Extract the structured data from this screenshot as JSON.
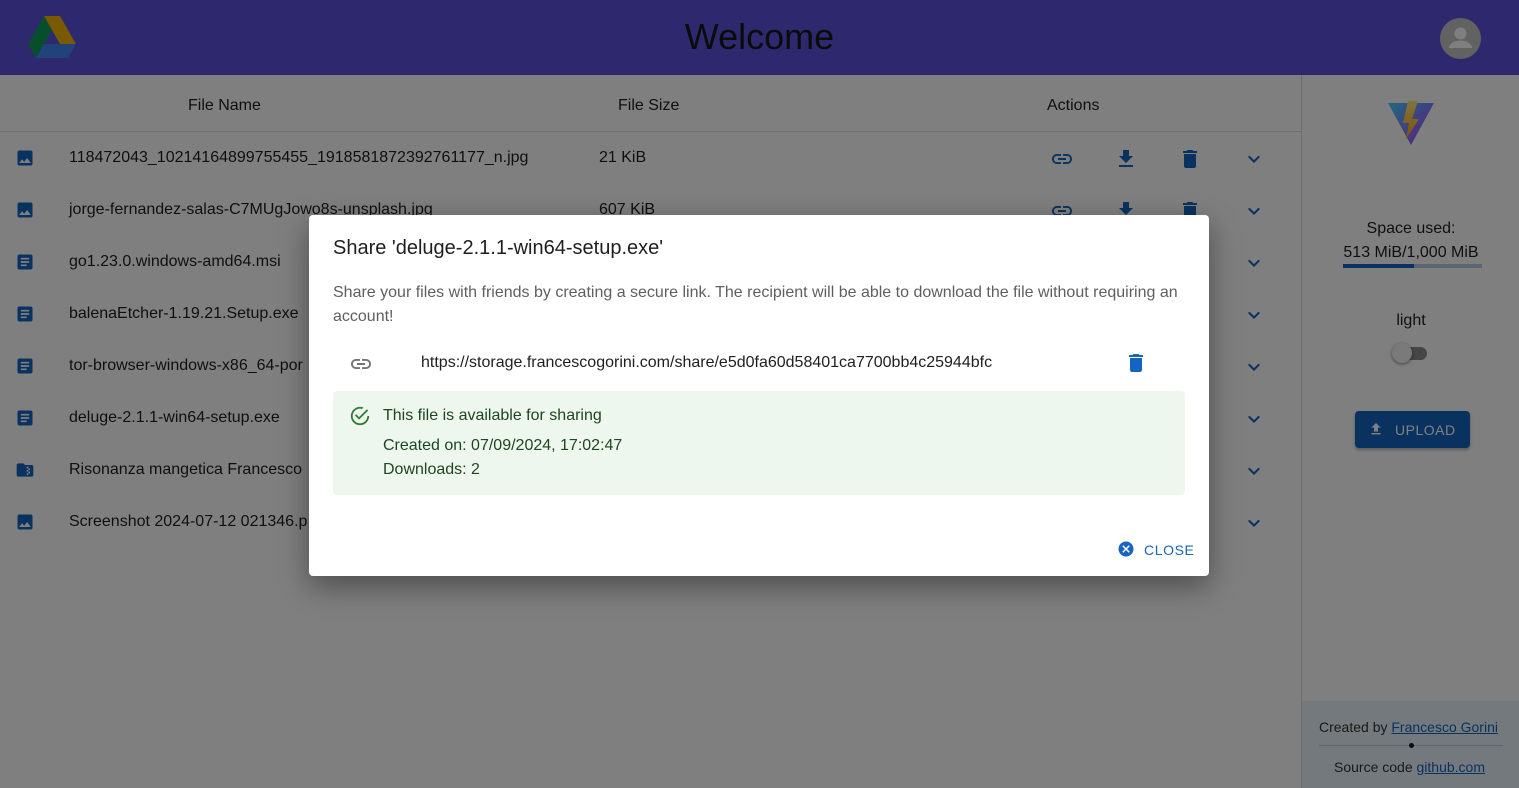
{
  "header": {
    "title": "Welcome"
  },
  "table": {
    "columns": {
      "name": "File Name",
      "size": "File Size",
      "actions": "Actions"
    },
    "rows": [
      {
        "icon": "image-icon",
        "name": "118472043_10214164899755455_1918581872392761177_n.jpg",
        "size": "21 KiB"
      },
      {
        "icon": "image-icon",
        "name": "jorge-fernandez-salas-C7MUgJowo8s-unsplash.jpg",
        "size": "607 KiB"
      },
      {
        "icon": "document-icon",
        "name": "go1.23.0.windows-amd64.msi",
        "size": ""
      },
      {
        "icon": "document-icon",
        "name": "balenaEtcher-1.19.21.Setup.exe",
        "size": ""
      },
      {
        "icon": "document-icon",
        "name": "tor-browser-windows-x86_64-por",
        "size": ""
      },
      {
        "icon": "document-icon",
        "name": "deluge-2.1.1-win64-setup.exe",
        "size": ""
      },
      {
        "icon": "archive-icon",
        "name": "Risonanza mangetica Francesco",
        "size": ""
      },
      {
        "icon": "image-icon",
        "name": "Screenshot 2024-07-12 021346.p",
        "size": ""
      }
    ]
  },
  "sidebar": {
    "space_label": "Space used:",
    "space_value": "513 MiB/1,000 MiB",
    "space_fraction": 0.513,
    "theme_label": "light",
    "upload_label": "UPLOAD",
    "footer": {
      "created_by": "Created by",
      "author": "Francesco Gorini",
      "source_code": "Source code",
      "source_link": "github.com"
    }
  },
  "dialog": {
    "title": "Share 'deluge-2.1.1-win64-setup.exe'",
    "description": "Share your files with friends by creating a secure link. The recipient will be able to download the file without requiring an account!",
    "link_url": "https://storage.francescogorini.com/share/e5d0fa60d58401ca7700bb4c25944bfc",
    "alert_title": "This file is available for sharing",
    "created_on": "Created on: 07/09/2024, 17:02:47",
    "downloads": "Downloads: 2",
    "close_label": "CLOSE"
  },
  "colors": {
    "header": "#5c52dd",
    "primary": "#1565c0",
    "alert_bg": "#edf7ed",
    "alert_text": "#1e4620"
  }
}
